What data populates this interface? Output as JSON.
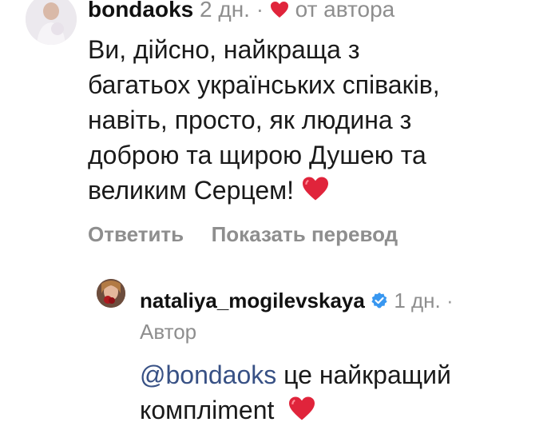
{
  "comment": {
    "username": "bondaoks",
    "time": "2 дн.",
    "separator": "·",
    "liked_by_author": "от автора",
    "text_lines": [
      "Ви, дійсно, найкраща з",
      "багатьох українських співаків,",
      "навіть, просто, як людина з",
      "доброю та щирою Душею та",
      "великим Серцем!"
    ],
    "actions": {
      "reply": "Ответить",
      "translate": "Показать перевод"
    }
  },
  "reply": {
    "username": "nataliya_mogilevskaya",
    "time": "1 дн.",
    "separator": "·",
    "author_badge": "Автор",
    "mention": "@bondaoks",
    "text_line1": "це найкращий",
    "text_line2": "компліment"
  },
  "colors": {
    "heart": "#e0243b",
    "verified": "#3897f0",
    "mention": "#385185",
    "secondary_text": "#8e8e8e"
  },
  "icons": {
    "heart": "heart-icon",
    "verified": "verified-badge-icon"
  }
}
